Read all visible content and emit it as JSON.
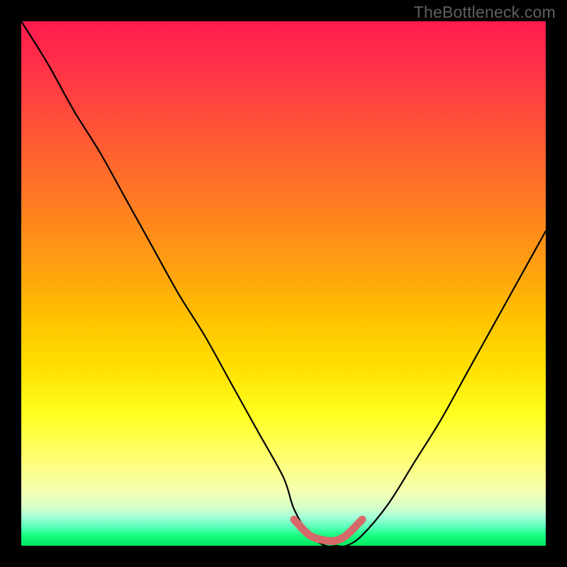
{
  "watermark": "TheBottleneck.com",
  "chart_data": {
    "type": "line",
    "title": "",
    "xlabel": "",
    "ylabel": "",
    "xlim": [
      0,
      100
    ],
    "ylim": [
      0,
      100
    ],
    "grid": false,
    "series": [
      {
        "name": "bottleneck-curve",
        "x": [
          0,
          5,
          10,
          15,
          20,
          25,
          30,
          35,
          40,
          45,
          50,
          52,
          55,
          58,
          60,
          62,
          65,
          70,
          75,
          80,
          85,
          90,
          95,
          100
        ],
        "y": [
          100,
          92,
          83,
          75,
          66,
          57,
          48,
          40,
          31,
          22,
          13,
          7,
          2,
          0,
          0,
          0,
          2,
          8,
          16,
          24,
          33,
          42,
          51,
          60
        ]
      },
      {
        "name": "optimal-band",
        "x": [
          52,
          55,
          58,
          60,
          62,
          65
        ],
        "y": [
          5,
          2,
          1,
          1,
          2,
          5
        ]
      }
    ]
  }
}
